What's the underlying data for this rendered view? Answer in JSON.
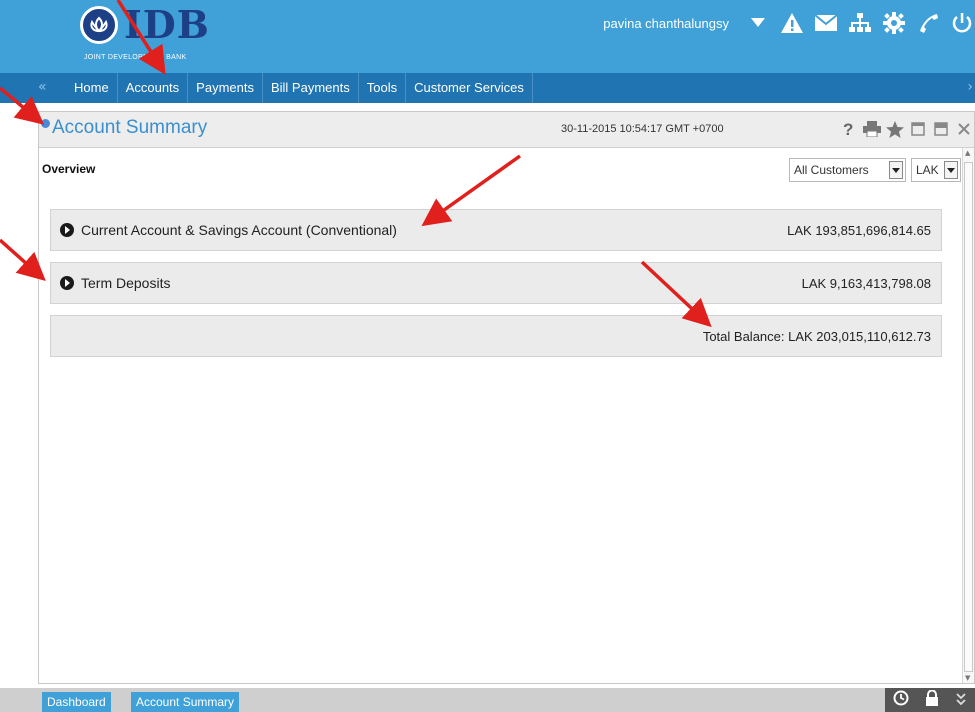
{
  "header": {
    "logo_text": "IDB",
    "logo_subtitle": "JOINT DEVELOPMENT BANK",
    "user_name": "pavina chanthalungsy",
    "icons": [
      "alert-icon",
      "mail-icon",
      "sitemap-icon",
      "gear-icon",
      "phone-icon",
      "power-icon"
    ]
  },
  "nav": {
    "collapse_glyph": "«",
    "items": [
      "Home",
      "Accounts",
      "Payments",
      "Bill Payments",
      "Tools",
      "Customer Services"
    ],
    "right_glyph": "›"
  },
  "panel": {
    "title": "Account Summary",
    "datetime": "30-11-2015 10:54:17 GMT +0700",
    "tools": [
      "help-icon",
      "print-icon",
      "favorite-icon",
      "minimize-icon",
      "detach-icon",
      "close-icon"
    ],
    "overview_label": "Overview",
    "customer_filter": "All Customers",
    "currency_filter": "LAK",
    "rows": [
      {
        "label": "Current Account & Savings Account (Conventional)",
        "amount": "LAK 193,851,696,814.65"
      },
      {
        "label": "Term Deposits",
        "amount": "LAK 9,163,413,798.08"
      }
    ],
    "total": "Total Balance: LAK 203,015,110,612.73"
  },
  "taskbar": {
    "tabs": [
      "Dashboard",
      "Account Summary"
    ],
    "icons": [
      "clock-icon",
      "lock-icon",
      "expand-icon"
    ]
  },
  "colors": {
    "header_blue": "#3fa1d8",
    "nav_blue": "#1f74b1",
    "brand_navy": "#1d3f85",
    "annotation_red": "#e0201c"
  }
}
